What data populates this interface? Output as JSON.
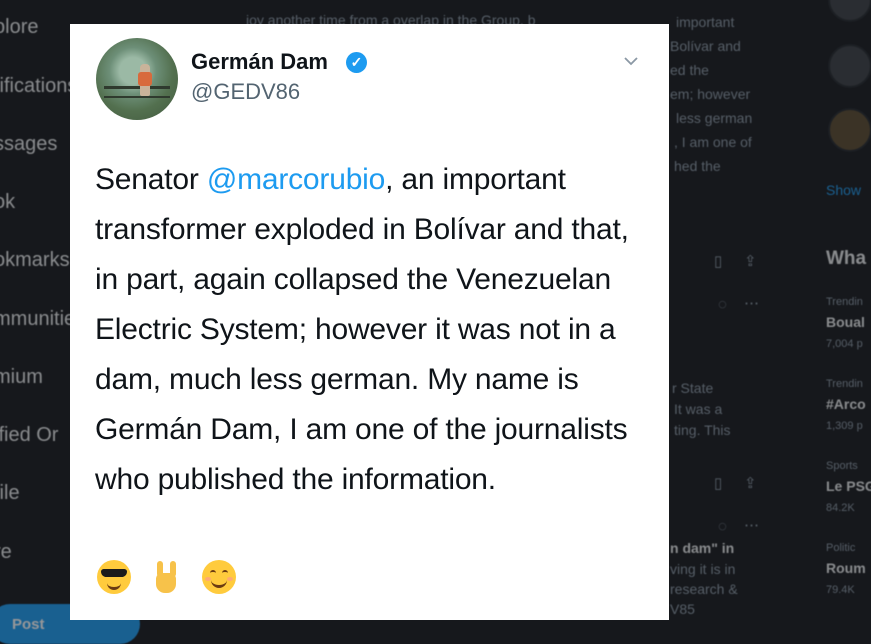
{
  "nav": {
    "items": [
      "plore",
      "tifications",
      "ssages",
      "ok",
      "okmarks",
      "mmunities",
      "mium",
      "ified Or",
      "file",
      "re"
    ],
    "post_label": "Post"
  },
  "middle": {
    "lines_top": [
      "joy another time from a overlap in the Group, b",
      "important",
      "Bolívar and",
      "ed the",
      "em; however",
      "less german",
      ", I am one of",
      "hed the"
    ],
    "lines_mid": [
      "r State",
      "It was a",
      "ting. This"
    ],
    "lines_low": [
      "n dam\" in",
      "ving it is in",
      "research &",
      "V85"
    ]
  },
  "right": {
    "show_more": "Show",
    "heading": "Wha",
    "trends": [
      {
        "meta": "Trendin",
        "name": "Boual",
        "count": "7,004 p"
      },
      {
        "meta": "Trendin",
        "name": "#Arco",
        "count": "1,309 p"
      },
      {
        "meta": "Sports",
        "name": "Le PSG",
        "count": "84.2K"
      },
      {
        "meta": "Politic",
        "name": "Roum",
        "count": "79.4K"
      }
    ]
  },
  "tweet": {
    "author_name": "Germán Dam",
    "author_handle": "@GEDV86",
    "text_before": "Senator ",
    "mention": "@marcorubio",
    "text_after": ", an important transformer exploded in Bolívar and that, in part, again collapsed the Venezuelan Electric System; however it was not in a dam, much less german. My name is Germán Dam, I am one of the journalists who published the information.",
    "emojis": [
      "smiling-face-with-sunglasses",
      "sign-of-the-horns",
      "smiling-face-with-smiling-eyes"
    ]
  },
  "colors": {
    "accent": "#1d9bf0",
    "background": "#16181c",
    "card": "#ffffff"
  }
}
